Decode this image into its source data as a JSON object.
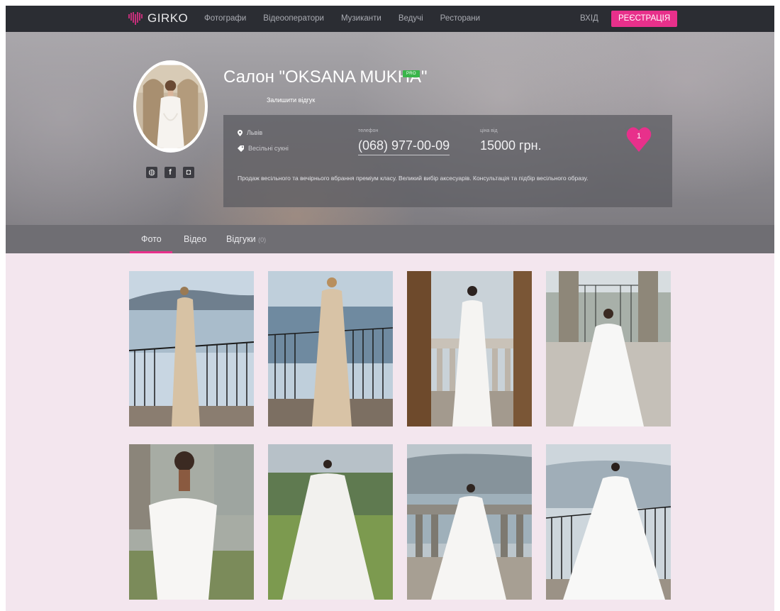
{
  "brand": {
    "name": "GIRKO",
    "accent": "#e8308b"
  },
  "nav": {
    "links": [
      "Фотографи",
      "Відеооператори",
      "Музиканти",
      "Ведучі",
      "Ресторани"
    ],
    "login": "ВХІД",
    "register": "РЕЄСТРАЦІЯ"
  },
  "profile": {
    "title": "Салон \"OKSANA MUKHA\"",
    "badge": "PRO",
    "review_link": "Залишити відгук",
    "location": "Львів",
    "category": "Весільні сукні",
    "phone_label": "телефон",
    "phone": "(068) 977-00-09",
    "price_label": "ціна від",
    "price": "15000 грн.",
    "description": "Продаж весільного та вечірнього вбрання преміум класу. Великий вибір аксесуарів. Консультація та підбір весільного образу.",
    "likes": "1",
    "socials": [
      "website-icon",
      "facebook-icon",
      "instagram-icon"
    ]
  },
  "tabs": [
    {
      "label": "Фото",
      "count": ""
    },
    {
      "label": "Відео",
      "count": ""
    },
    {
      "label": "Відгуки",
      "count": "(0)"
    }
  ],
  "gallery": {
    "photos": [
      "photo-1",
      "photo-2",
      "photo-3",
      "photo-4",
      "photo-5",
      "photo-6",
      "photo-7",
      "photo-8"
    ]
  }
}
